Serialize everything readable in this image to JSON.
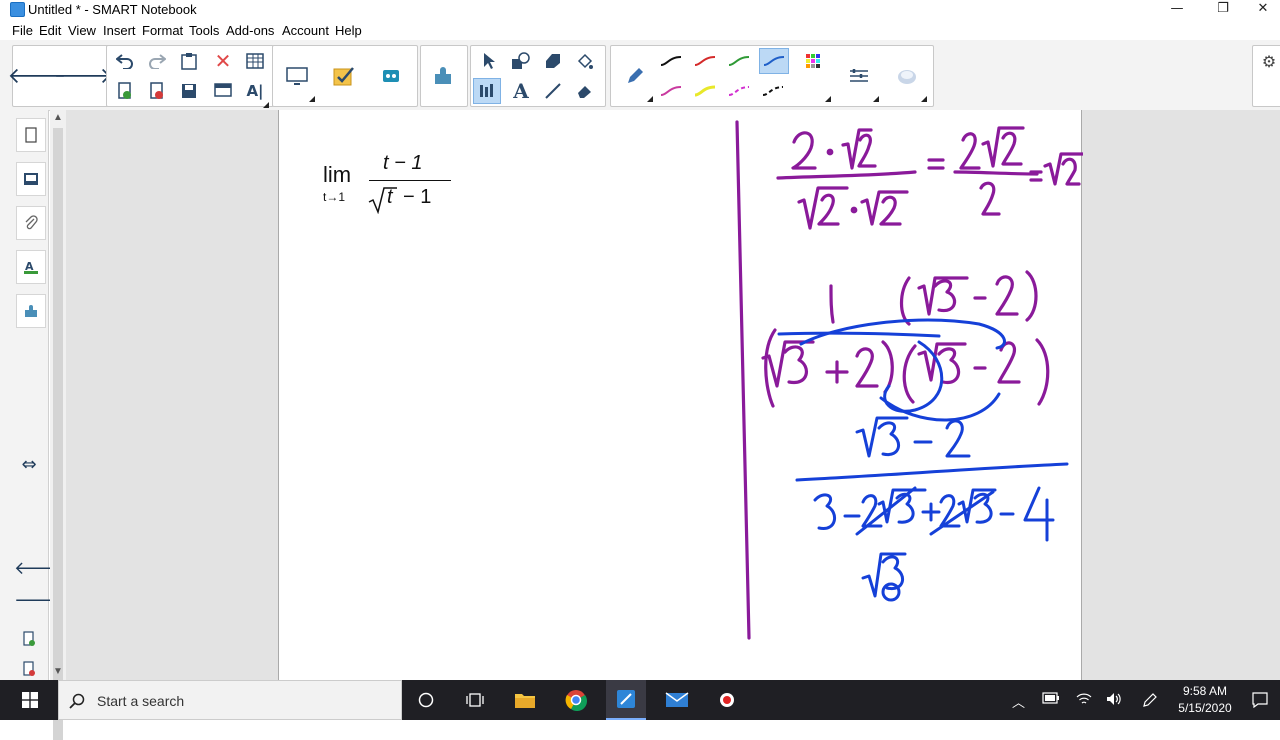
{
  "window": {
    "title": "Untitled * - SMART Notebook",
    "minimize": "—",
    "restore": "❐",
    "close": "✕"
  },
  "menu": [
    "File",
    "Edit",
    "View",
    "Insert",
    "Format",
    "Tools",
    "Add-ons",
    "Account",
    "Help"
  ],
  "toolbar": {
    "back_glyph": "🡐",
    "forward_glyph": "🡒",
    "icons": {
      "undo": "undo-icon",
      "redo": "redo-icon",
      "paste": "paste-icon",
      "delete": "delete-icon",
      "table": "table-icon",
      "add_page": "add-page-icon",
      "delete_page": "delete-page-icon",
      "save": "save-icon",
      "screen_shade": "screen-shade-icon",
      "text_format": "text-format-icon",
      "display": "display-icon",
      "response": "response-icon",
      "lab": "lab-icon",
      "addons": "addons-icon",
      "select": "select-icon",
      "shapes": "shapes-icon",
      "eraser_shape": "eraser-shape-icon",
      "fill": "fill-icon",
      "measure": "measure-icon",
      "text": "text-icon",
      "line": "line-icon",
      "eraser": "eraser-icon",
      "pen": "pen-icon",
      "color_palette": "color-palette-icon",
      "line_settings": "line-settings-icon",
      "fill_effect": "fill-effect-icon"
    },
    "pen_colors": [
      "#111111",
      "#d42a2a",
      "#2f9a36",
      "#1f5fc8",
      "#c93a9f",
      "#e8e82a",
      "#d22fd0",
      "#111111"
    ]
  },
  "sidebar": {
    "icons": [
      "page-sorter-icon",
      "gallery-icon",
      "attachments-icon",
      "properties-icon",
      "addons-tab-icon"
    ],
    "move_glyph": "⇔",
    "prev_glyph": "🡐",
    "next_glyph": "🡒"
  },
  "canvas": {
    "formula": {
      "lim": "lim",
      "sub": "t→1",
      "numerator": "t − 1",
      "radicand": "t",
      "minus_one": " − 1"
    },
    "ink_colors": {
      "purple": "#8a1a9a",
      "blue": "#1540d8"
    }
  },
  "taskbar": {
    "search_placeholder": "Start a search",
    "time": "9:58 AM",
    "date": "5/15/2020"
  }
}
